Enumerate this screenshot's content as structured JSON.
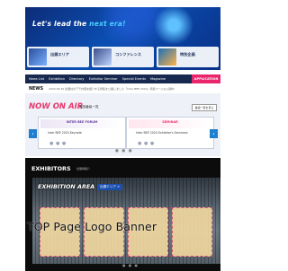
{
  "hero": {
    "tagline_main": "Let's lead the ",
    "tagline_accent": "next era!",
    "cards": [
      {
        "label": "出展エリア",
        "sub": ""
      },
      {
        "label": "コンファレンス",
        "sub": ""
      },
      {
        "label": "特別企画",
        "sub": ""
      }
    ]
  },
  "nav": {
    "items": [
      "News List",
      "Exhibition",
      "Directory",
      "Exhibitor Seminar",
      "Special Events",
      "Magazine"
    ],
    "cta": "APPLICATION"
  },
  "news": {
    "label": "NEWS",
    "text": "2024.09.30 出展社のデモ内容を紹介する特集を公開しました「Inter BEE 2024」特集ページも公開中"
  },
  "onair": {
    "title_now": "NOW ",
    "title_air": "ON AIR",
    "subtitle": "配信番組一覧",
    "more": "番組一覧を見る",
    "slides": [
      {
        "head": "INTER BEE FORUM",
        "caption": "Inter BEE 2024 Keynote",
        "head_color": "#6a3fa0"
      },
      {
        "head": "SEMINAR",
        "caption": "Inter BEE 2024 Exhibitor's Seminars",
        "head_color": "#e8386e"
      }
    ],
    "prev": "‹",
    "next": "›"
  },
  "exhibitors": {
    "heading": "EXHIBITORS",
    "heading_sub": "出展者紹介",
    "area_title": "EXHIBITION AREA",
    "area_button": "出展エリア >"
  },
  "overlay": {
    "text": "TOP Page Logo Banner"
  },
  "colors": {
    "nav_bg": "#17294f",
    "cta": "#e9256b",
    "onair_pink": "#e8386e",
    "arrow_blue": "#1e7fcf"
  }
}
